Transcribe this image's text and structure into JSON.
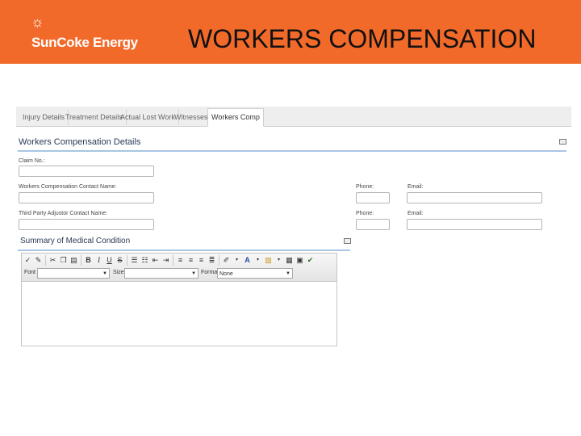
{
  "banner": {
    "logo_text": "SunCoke Energy",
    "title": "WORKERS COMPENSATION",
    "color": "#f26a2a"
  },
  "tabs": [
    {
      "label": "Injury Details",
      "active": false
    },
    {
      "label": "Treatment Details",
      "active": false
    },
    {
      "label": "Actual Lost Work",
      "active": false
    },
    {
      "label": "Witnesses",
      "active": false
    },
    {
      "label": "Workers Comp",
      "active": true
    }
  ],
  "details": {
    "heading": "Workers Compensation Details",
    "claim_label": "Claim No.:",
    "claim_value": "",
    "contact_label": "Workers Compensation Contact Name:",
    "contact_value": "",
    "contact_phone_label": "Phone:",
    "contact_email_label": "Email:",
    "adjustor_label": "Third Party Adjustor Contact Name:",
    "adjustor_value": "",
    "adjustor_phone_label": "Phone:",
    "adjustor_email_label": "Email:"
  },
  "medical": {
    "heading": "Summary of Medical Condition",
    "font_label": "Font",
    "font_value": "",
    "size_label": "Size",
    "size_value": "",
    "format_label": "Format",
    "format_value": "None",
    "body": ""
  },
  "toolbar_icons": [
    "source-icon",
    "paste-text-icon",
    "cut-icon",
    "copy-icon",
    "paste-icon",
    "bold-icon",
    "italic-icon",
    "underline-icon",
    "strikethrough-icon",
    "ordered-list-icon",
    "unordered-list-icon",
    "outdent-icon",
    "indent-icon",
    "align-left-icon",
    "align-center-icon",
    "align-right-icon",
    "justify-icon",
    "highlight-icon",
    "text-color-icon",
    "background-color-icon",
    "table-icon",
    "spellcheck-icon"
  ],
  "colors": {
    "section_line": "#a9c6e4",
    "heading_text": "#2b3a55"
  }
}
